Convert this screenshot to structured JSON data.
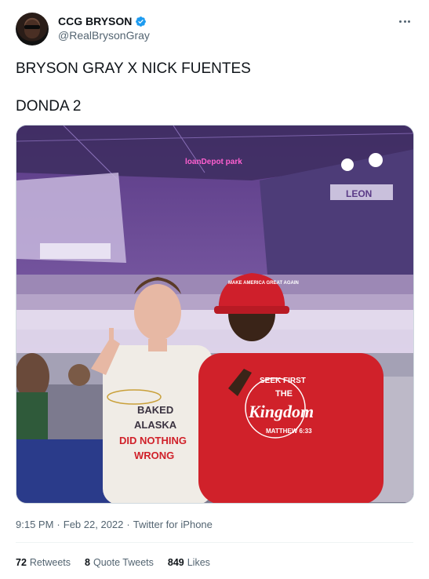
{
  "user": {
    "display_name": "CCG BRYSON",
    "handle": "@RealBrysonGray",
    "verified": true,
    "avatar_icon": "avatar-photo"
  },
  "tweet": {
    "lines": [
      "BRYSON GRAY X NICK FUENTES",
      "DONDA 2"
    ],
    "media": {
      "stadium_sign": "loanDepot park",
      "stand_sign": "LEON",
      "cap_text": "MAKE AMERICA GREAT AGAIN",
      "shirt_text": [
        "BAKED",
        "ALASKA",
        "DID NOTHING",
        "WRONG"
      ],
      "hoodie_text": [
        "SEEK FIRST",
        "THE",
        "Kingdom",
        "MATTHEW 6:33"
      ]
    }
  },
  "meta": {
    "time": "9:15 PM",
    "separator": "·",
    "date": "Feb 22, 2022",
    "source": "Twitter for iPhone"
  },
  "stats": {
    "retweets_count": "72",
    "retweets_label": "Retweets",
    "quotes_count": "8",
    "quotes_label": "Quote Tweets",
    "likes_count": "849",
    "likes_label": "Likes"
  },
  "colors": {
    "verified": "#1d9bf0",
    "text_secondary": "#536471",
    "text_primary": "#0f1419",
    "hoodie_red": "#d0212a",
    "cap_red": "#cf1f2b"
  }
}
